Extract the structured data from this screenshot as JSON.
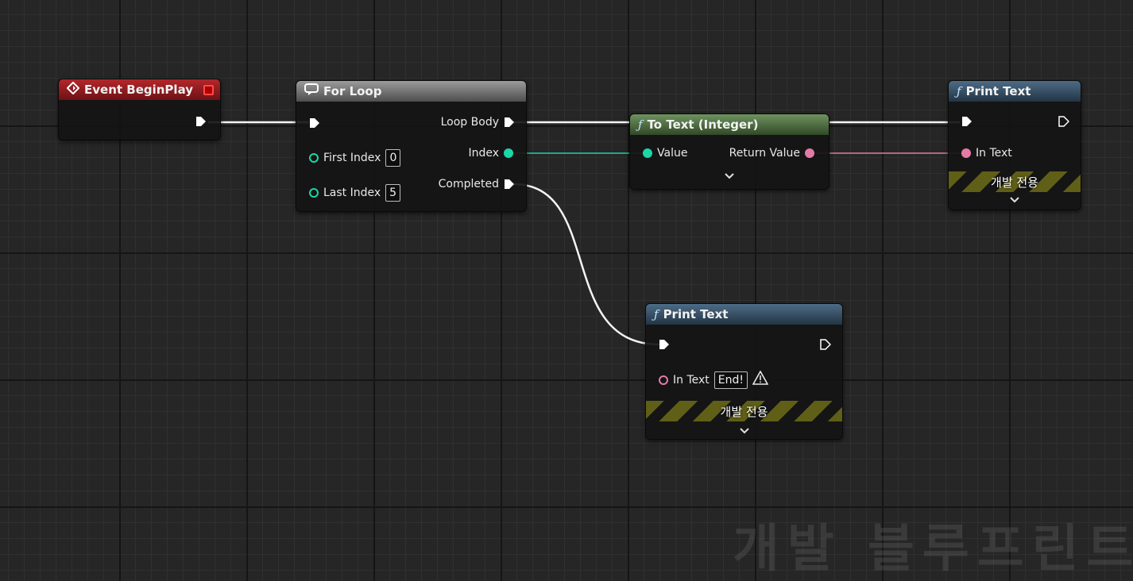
{
  "nodes": {
    "event_begin_play": {
      "title": "Event BeginPlay"
    },
    "for_loop": {
      "title": "For Loop",
      "first_index_label": "First Index",
      "first_index_value": "0",
      "last_index_label": "Last Index",
      "last_index_value": "5",
      "loop_body_label": "Loop Body",
      "index_label": "Index",
      "completed_label": "Completed"
    },
    "to_text": {
      "title": "To Text (Integer)",
      "value_label": "Value",
      "return_value_label": "Return Value"
    },
    "print_text_top": {
      "title": "Print Text",
      "in_text_label": "In Text",
      "dev_only_label": "개발 전용"
    },
    "print_text_bottom": {
      "title": "Print Text",
      "in_text_label": "In Text",
      "in_text_value": "End!",
      "dev_only_label": "개발 전용"
    }
  },
  "watermark": "개발 블루프린트",
  "colors": {
    "event_header": "#b3262a",
    "loop_header": "#9b9b9b",
    "function_header": "#4d6c86",
    "pure_header": "#6e9360",
    "integer_pin": "#1bd6a6",
    "text_pin": "#e27ba5",
    "exec_wire": "#ffffff"
  }
}
